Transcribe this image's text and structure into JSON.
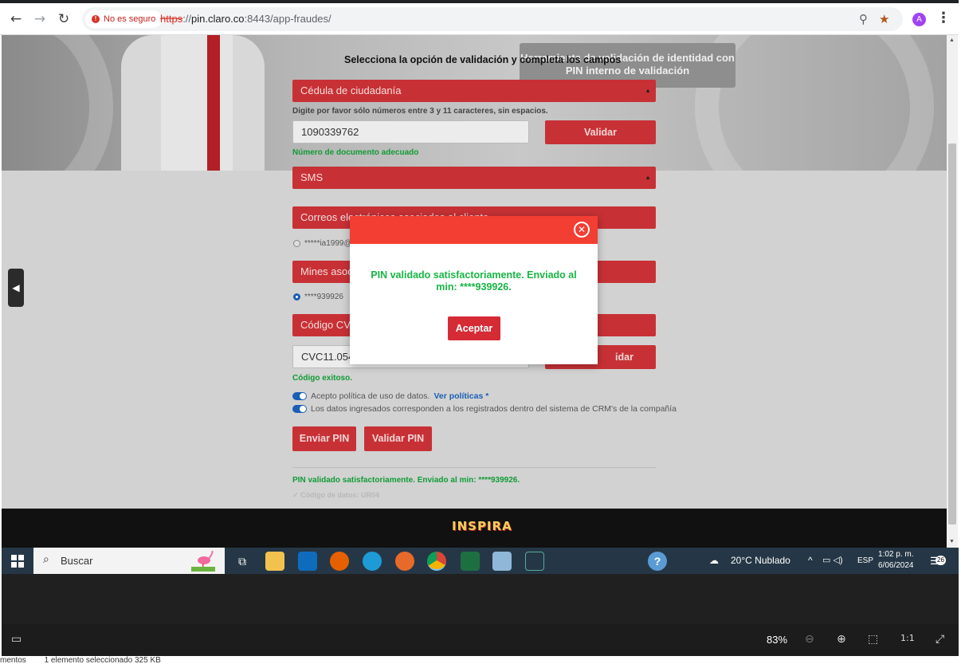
{
  "browser": {
    "security_label": "No es seguro",
    "url_scheme": "https",
    "url_host": "pin.claro.co",
    "url_rest": ":8443/app-fraudes/",
    "profile_initial": "A",
    "icons": [
      "back-icon",
      "forward-icon",
      "reload-icon",
      "zoom-icon",
      "star-icon",
      "menu-icon"
    ]
  },
  "page": {
    "title": "Selecciona la opción de validación y completa los campos",
    "tooltip": "Herramienta de validación de identidad con PIN interno de validación",
    "doc_type": "Cédula de ciudadanía",
    "hint": "Digite por favor sólo números entre 3 y 11 caracteres, sin espacios.",
    "doc_value": "1090339762",
    "validate_label": "Validar",
    "doc_ok": "Número de documento adecuado",
    "channel": "SMS",
    "emails_label": "Correos electrónicos asociados al cliente",
    "email_option": "*****ia1999@",
    "mines_label": "Mines asoc",
    "mine_option": "****939926",
    "cvc_label": "Código CVC",
    "cvc_value": "CVC11.054",
    "cvc_validate": "idar",
    "cvc_ok": "Código exitoso.",
    "policy_text": "Acepto política de uso de datos.",
    "policy_link": "Ver políticas *",
    "crm_text": "Los datos ingresados corresponden a los registrados dentro del sistema de CRM's de la compañía",
    "send_pin": "Enviar PIN",
    "validate_pin": "Validar PIN",
    "result": "PIN validado satisfactoriamente. Enviado al min: ****939926.",
    "faded_note": "✓ Código de datos: UR04",
    "footer_logo": "INSPIRA"
  },
  "modal": {
    "message": "PIN validado satisfactoriamente. Enviado al min: ****939926.",
    "accept": "Aceptar",
    "colors": {
      "header": "#f23e33",
      "message": "#18b544",
      "button": "#d52b35"
    }
  },
  "taskbar": {
    "search_placeholder": "Buscar",
    "weather": "20°C  Nublado",
    "lang": "ESP",
    "time": "1:02 p. m.",
    "date": "6/06/2024",
    "notifications": "26"
  },
  "viewer": {
    "zoom": "83%"
  },
  "status_bar": {
    "left": "mentos",
    "selection": "1 elemento seleccionado  325 KB"
  }
}
